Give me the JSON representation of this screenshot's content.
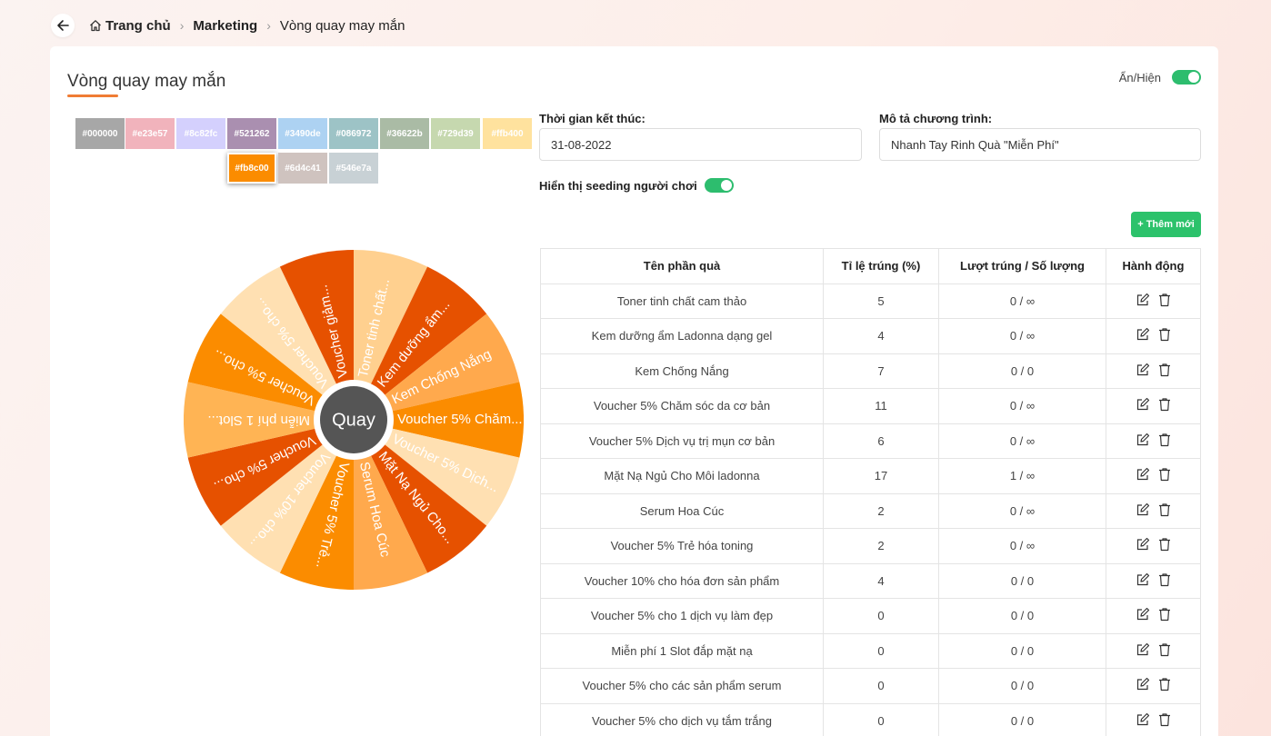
{
  "breadcrumb": {
    "home": "Trang chủ",
    "section": "Marketing",
    "current": "Vòng quay may mắn"
  },
  "card": {
    "title": "Vòng quay may mắn",
    "visibility_label": "Ẩn/Hiện",
    "visibility_on": true
  },
  "colors": [
    {
      "hex": "#000000",
      "display": "#000000",
      "swatch": "#a7a7a7",
      "selected": false
    },
    {
      "hex": "#e23e57",
      "display": "#e23e57",
      "swatch": "#f1b3bc",
      "selected": false
    },
    {
      "hex": "#8c82fc",
      "display": "#8c82fc",
      "swatch": "#d4d0fd",
      "selected": false
    },
    {
      "hex": "#521262",
      "display": "#521262",
      "swatch": "#aa8fb0",
      "selected": false
    },
    {
      "hex": "#3490de",
      "display": "#3490de",
      "swatch": "#add2f2",
      "selected": false
    },
    {
      "hex": "#086972",
      "display": "#086972",
      "swatch": "#9dc3c6",
      "selected": false
    },
    {
      "hex": "#36622b",
      "display": "#36622b",
      "swatch": "#aabba5",
      "selected": false
    },
    {
      "hex": "#729d39",
      "display": "#729d39",
      "swatch": "#c6d8af",
      "selected": false
    },
    {
      "hex": "#ffb400",
      "display": "#ffb400",
      "swatch": "#ffe29e",
      "selected": false
    },
    {
      "hex": "#fb8c00",
      "display": "#fb8c00",
      "swatch": "#fb8c00",
      "selected": true
    },
    {
      "hex": "#6d4c41",
      "display": "#6d4c41",
      "swatch": "#cfc3bf",
      "selected": false
    },
    {
      "hex": "#546e7a",
      "display": "#546e7a",
      "swatch": "#c8d1d5",
      "selected": false
    }
  ],
  "form": {
    "end_time_label": "Thời gian kết thúc:",
    "end_time_value": "31-08-2022",
    "desc_label": "Mô tả chương trình:",
    "desc_value": "Nhanh Tay Rinh Quà \"Miễn Phí\"",
    "seeding_label": "Hiển thị seeding người chơi",
    "seeding_on": true
  },
  "add_button": "+ Thêm mới",
  "spin_button": "Quay",
  "wheel": {
    "labels": [
      "Toner tinh chất...",
      "Kem dưỡng ẩm...",
      "Kem Chống Nắng",
      "Voucher 5% Chăm...",
      "Voucher 5% Dịch...",
      "Mặt Nạ Ngủ Cho...",
      "Serum Hoa Cúc",
      "Voucher 5% Trẻ...",
      "Voucher 10% cho...",
      "Voucher 5% cho...",
      "Miễn phí 1 Slot...",
      "Voucher 5% cho...",
      "Voucher 5% cho...",
      "Voucher giảm..."
    ],
    "colors": [
      "#ffd08f",
      "#e65100",
      "#ffa94d",
      "#fb8c00",
      "#ffe0b2",
      "#e65100",
      "#ffa94d",
      "#fb8c00",
      "#ffe0b2",
      "#e65100",
      "#ffb454",
      "#fb8c00",
      "#ffe0b2",
      "#e65100"
    ]
  },
  "table": {
    "headers": [
      "Tên phần quà",
      "Tỉ lệ trúng (%)",
      "Lượt trúng / Số lượng",
      "Hành động"
    ],
    "rows": [
      {
        "name": "Toner tinh chất cam thảo",
        "rate": "5",
        "count": "0 / ∞"
      },
      {
        "name": "Kem dưỡng ẩm Ladonna dạng gel",
        "rate": "4",
        "count": "0 / ∞"
      },
      {
        "name": "Kem Chống Nắng",
        "rate": "7",
        "count": "0 / 0"
      },
      {
        "name": "Voucher 5% Chăm sóc da cơ bản",
        "rate": "11",
        "count": "0 / ∞"
      },
      {
        "name": "Voucher 5% Dịch vụ trị mụn cơ bản",
        "rate": "6",
        "count": "0 / ∞"
      },
      {
        "name": "Mặt Nạ Ngủ Cho Môi ladonna",
        "rate": "17",
        "count": "1 / ∞"
      },
      {
        "name": "Serum Hoa Cúc",
        "rate": "2",
        "count": "0 / ∞"
      },
      {
        "name": "Voucher 5% Trẻ hóa toning",
        "rate": "2",
        "count": "0 / ∞"
      },
      {
        "name": "Voucher 10% cho hóa đơn sản phẩm",
        "rate": "4",
        "count": "0 / 0"
      },
      {
        "name": "Voucher 5% cho 1 dịch vụ làm đẹp",
        "rate": "0",
        "count": "0 / 0"
      },
      {
        "name": "Miễn phí 1 Slot đắp mặt nạ",
        "rate": "0",
        "count": "0 / 0"
      },
      {
        "name": "Voucher 5% cho các sản phẩm serum",
        "rate": "0",
        "count": "0 / 0"
      },
      {
        "name": "Voucher 5% cho dịch vụ tắm trắng",
        "rate": "0",
        "count": "0 / 0"
      }
    ]
  }
}
